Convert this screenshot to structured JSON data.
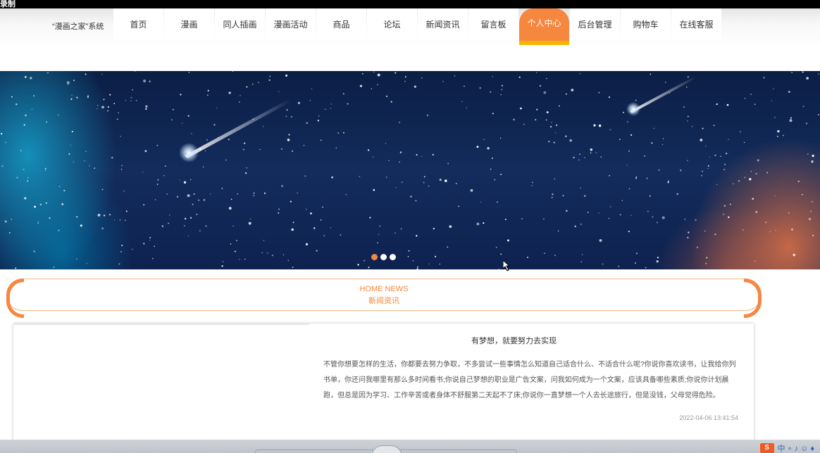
{
  "recording": {
    "label": "录制"
  },
  "header": {
    "logo": "“漫画之家”系统",
    "nav": [
      {
        "label": "首页"
      },
      {
        "label": "漫画"
      },
      {
        "label": "同人插画"
      },
      {
        "label": "漫画活动"
      },
      {
        "label": "商品"
      },
      {
        "label": "论坛"
      },
      {
        "label": "新闻资讯"
      },
      {
        "label": "留言板"
      },
      {
        "label": "个人中心",
        "active": true
      },
      {
        "label": "后台管理"
      },
      {
        "label": "购物车"
      },
      {
        "label": "在线客服"
      }
    ],
    "accent_color": "#f6873f",
    "accent_underline": "#f8b500"
  },
  "banner": {
    "slides_total": 3,
    "active_slide": 1
  },
  "section": {
    "title_en": "HOME NEWS",
    "title_cn": "新闻资讯"
  },
  "news": {
    "title": "有梦想，就要努力去实现",
    "body": "不管你想要怎样的生活，你都要去努力争取，不多尝试一些事情怎么知道自己适合什么、不适合什么呢?你说你喜欢读书，让我给你列书单，你还问我哪里有那么多时间看书;你说自己梦想的职业是广告文案，问我如何成为一个文案，应该具备哪些素质;你说你计划晨跑，但总是因为学习、工作辛苦或者身体不舒服第二天起不了床;你说你一直梦想一个人去长途旅行，但是没钱，父母觉得危险。",
    "date": "2022-04-06 13:41:54"
  },
  "taskbar": {
    "tray_icon": "S",
    "tray_text": "中 ∘ ♪ ☺ ♦"
  }
}
